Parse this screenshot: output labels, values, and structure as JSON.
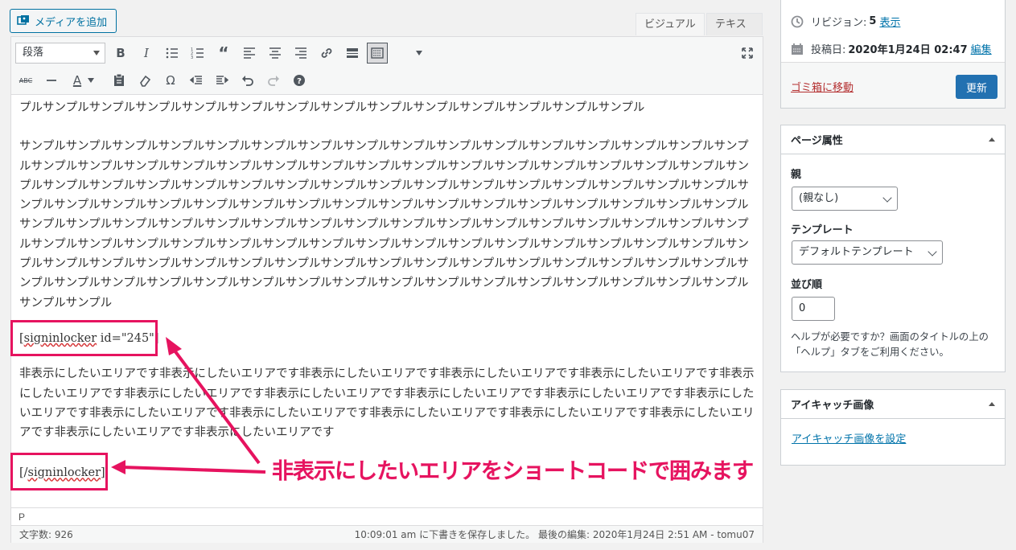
{
  "media_button": {
    "label": "メディアを追加",
    "icon": "media-add-icon"
  },
  "tabs": {
    "visual": "ビジュアル",
    "text": "テキスト"
  },
  "toolbar": {
    "format_select": "段落",
    "row1": [
      "bold-icon",
      "italic-icon",
      "bullet-list-icon",
      "numbered-list-icon",
      "blockquote-icon",
      "align-left-icon",
      "align-center-icon",
      "align-right-icon",
      "link-icon",
      "read-more-icon",
      "toolbar-toggle-icon",
      "dropdown-arrow-icon"
    ],
    "row2": [
      "strikethrough-icon",
      "horizontal-line-icon",
      "text-color-icon",
      "paste-text-icon",
      "clear-formatting-icon",
      "special-char-icon",
      "outdent-icon",
      "indent-icon",
      "undo-icon",
      "redo-icon",
      "help-icon"
    ],
    "fullscreen": "fullscreen-icon"
  },
  "content": {
    "para_top": "プルサンプルサンプルサンプルサンプルサンプルサンプルサンプルサンプルサンプルサンプルサンプルサンプルサンプル",
    "para_sample": "サンプルサンプルサンプルサンプルサンプルサンプルサンプルサンプルサンプルサンプルサンプルサンプルサンプルサンプルサンプルサンプルサンプルサンプルサンプルサンプルサンプルサンプルサンプルサンプルサンプルサンプルサンプルサンプルサンプルサンプルサンプルサンプルサンプルサンプルサンプルサンプルサンプルサンプルサンプルサンプルサンプルサンプルサンプルサンプルサンプルサンプルサンプルサンプルサンプルサンプルサンプルサンプルサンプルサンプルサンプルサンプルサンプルサンプルサンプルサンプルサンプルサンプルサンプルサンプルサンプルサンプルサンプルサンプルサンプルサンプルサンプルサンプルサンプルサンプルサンプルサンプルサンプルサンプルサンプルサンプルサンプルサンプルサンプルサンプルサンプルサンプルサンプルサンプルサンプルサンプルサンプルサンプルサンプルサンプルサンプルサンプルサンプルサンプルサンプルサンプルサンプルサンプルサンプルサンプルサンプルサンプルサンプルサンプルサンプルサンプルサンプルサンプルサンプルサンプルサンプルサンプルサンプルサンプルサンプルサンプルサンプルサンプルサンプルサンプルサンプルサンプルサンプルサンプル",
    "shortcode_open_name": "signinlocker",
    "shortcode_open_rest": " id=\"245\"]",
    "para_hidden": "非表示にしたいエリアです非表示にしたいエリアです非表示にしたいエリアです非表示にしたいエリアです非表示にしたいエリアです非表示にしたいエリアです非表示にしたいエリアです非表示にしたいエリアです非表示にしたいエリアです非表示にしたいエリアです非表示にしたいエリアです非表示にしたいエリアです非表示にしたいエリアです非表示にしたいエリアです非表示にしたいエリアです非表示にしたいエリアです非表示にしたいエリアです非表示にしたいエリアです",
    "shortcode_close_name": "signinlocker"
  },
  "annotation": {
    "callout": "非表示にしたいエリアをショートコードで囲みます",
    "color": "#e6135f"
  },
  "status": {
    "path": "P",
    "word_count": "文字数: 926",
    "autosave": "10:09:01 am に下書きを保存しました。 最後の編集: 2020年1月24日 2:51 AM - tomu07"
  },
  "publish": {
    "revisions_label": "リビジョン:",
    "revisions_count": "5",
    "revisions_link": "表示",
    "date_label": "投稿日:",
    "date_value": "2020年1月24日 02:47",
    "date_link": "編集",
    "trash": "ゴミ箱に移動",
    "update": "更新"
  },
  "page_attributes": {
    "title": "ページ属性",
    "parent_label": "親",
    "parent_value": "(親なし)",
    "template_label": "テンプレート",
    "template_value": "デフォルトテンプレート",
    "order_label": "並び順",
    "order_value": "0",
    "help": "ヘルプが必要ですか？画面のタイトルの上の「ヘルプ」タブをご利用ください。"
  },
  "featured_image": {
    "title": "アイキャッチ画像",
    "link": "アイキャッチ画像を設定"
  }
}
